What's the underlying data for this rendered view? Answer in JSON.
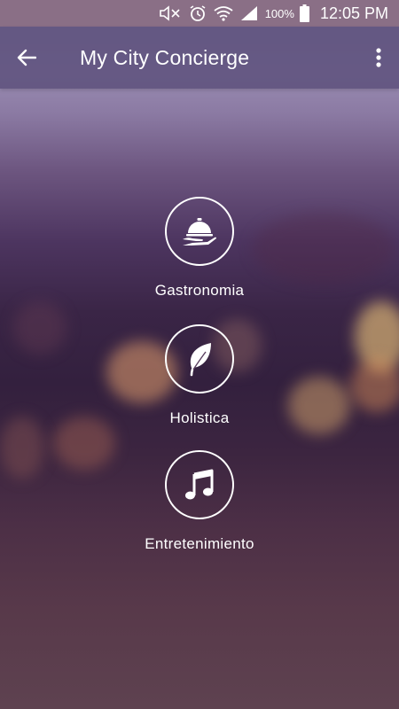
{
  "status_bar": {
    "battery_percent": "100%",
    "time": "12:05 PM",
    "icons": [
      "mute-icon",
      "alarm-icon",
      "wifi-icon",
      "signal-icon",
      "battery-icon"
    ]
  },
  "app_bar": {
    "title": "My City Concierge",
    "back_icon": "arrow-back-icon",
    "overflow_icon": "more-vert-icon"
  },
  "menu": {
    "items": [
      {
        "label": "Gastronomia",
        "icon": "food-tray-icon"
      },
      {
        "label": "Holistica",
        "icon": "leaf-icon"
      },
      {
        "label": "Entretenimiento",
        "icon": "music-note-icon"
      }
    ]
  },
  "colors": {
    "status_bar": "#8a6f86",
    "app_bar": "#5f527d",
    "foreground": "#ffffff"
  }
}
